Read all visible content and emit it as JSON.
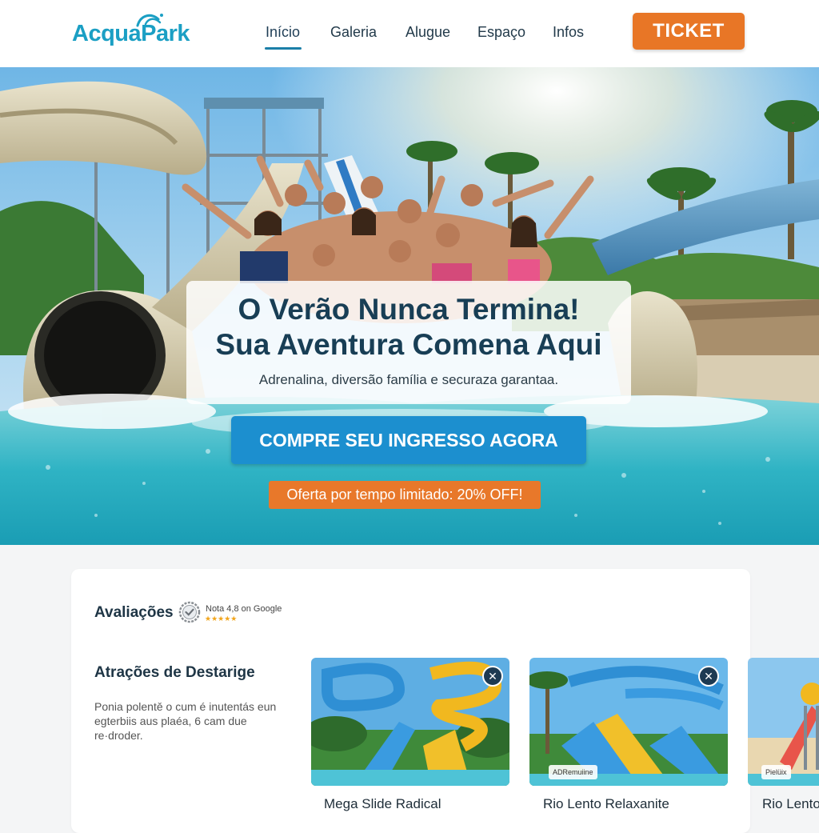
{
  "header": {
    "logo": "AcquaPark",
    "nav": [
      "Início",
      "Galeria",
      "Alugue",
      "Espaço",
      "Infos"
    ],
    "active_nav": "Início",
    "ticket_label": "TICKET"
  },
  "hero": {
    "headline_line1": "O Verão Nunca Termina!",
    "headline_line2": "Sua Aventura Comena Aqui",
    "subline": "Adrenalina, diversão família e securaza garantaa.",
    "cta_label": "COMPRE SEU INGRESSO AGORA",
    "offer_label": "Oferta por tempo limitado: 20% OFF!"
  },
  "reviews": {
    "title": "Avaliações",
    "badge_text": "Nota 4,8 on Google",
    "stars": "★★★★★"
  },
  "attractions": {
    "title": "Atrações de Destarige",
    "description": "Ponia polentě o cum é inutentás eun egterbiis aus plaéa, 6 cam due re·droder.",
    "items": [
      {
        "label": "Mega Slide Radical",
        "tag": ""
      },
      {
        "label": "Rio Lento Relaxanite",
        "tag": "ADRemuiine"
      },
      {
        "label": "Rio Lento",
        "tag": "Pielüix"
      }
    ]
  },
  "colors": {
    "brand": "#1b9fc4",
    "accent_orange": "#e87626",
    "cta_blue": "#1c8fcf",
    "dark_text": "#183e55"
  }
}
